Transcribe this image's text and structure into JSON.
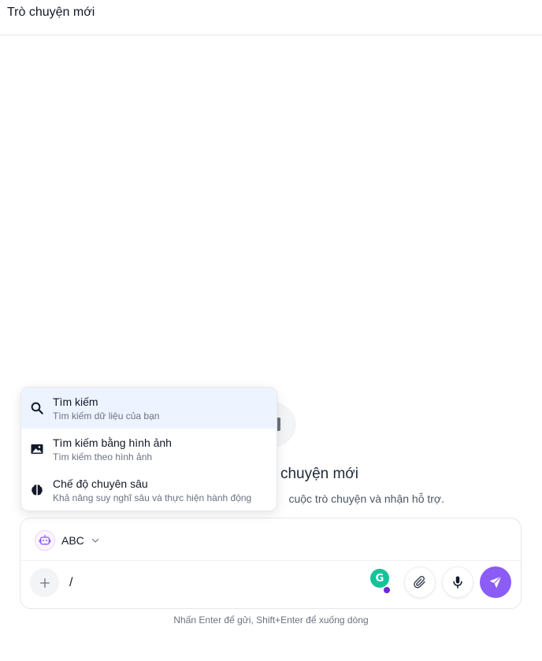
{
  "header": {
    "title": "Trò chuyện mới"
  },
  "welcome": {
    "title": "chuyện mới",
    "subtitle": "cuộc trò chuyện và nhận hỗ trợ."
  },
  "command_menu": {
    "items": [
      {
        "label": "Tìm kiếm",
        "description": "Tìm kiếm dữ liệu của bạn",
        "icon": "search-icon",
        "active": true
      },
      {
        "label": "Tìm kiếm bằng hình ảnh",
        "description": "Tìm kiếm theo hình ảnh",
        "icon": "image-icon",
        "active": false
      },
      {
        "label": "Chế độ chuyên sâu",
        "description": "Khả năng suy nghĩ sâu và thực hiện hành động",
        "icon": "brain-icon",
        "active": false
      }
    ]
  },
  "composer": {
    "model_name": "ABC",
    "input_value": "/",
    "grammarly_letter": "G"
  },
  "hint": "Nhấn Enter để gửi, Shift+Enter để xuống dòng",
  "colors": {
    "accent": "#8b5cf6",
    "active_item_bg": "#eef4ff",
    "grammarly": "#15c39a"
  }
}
